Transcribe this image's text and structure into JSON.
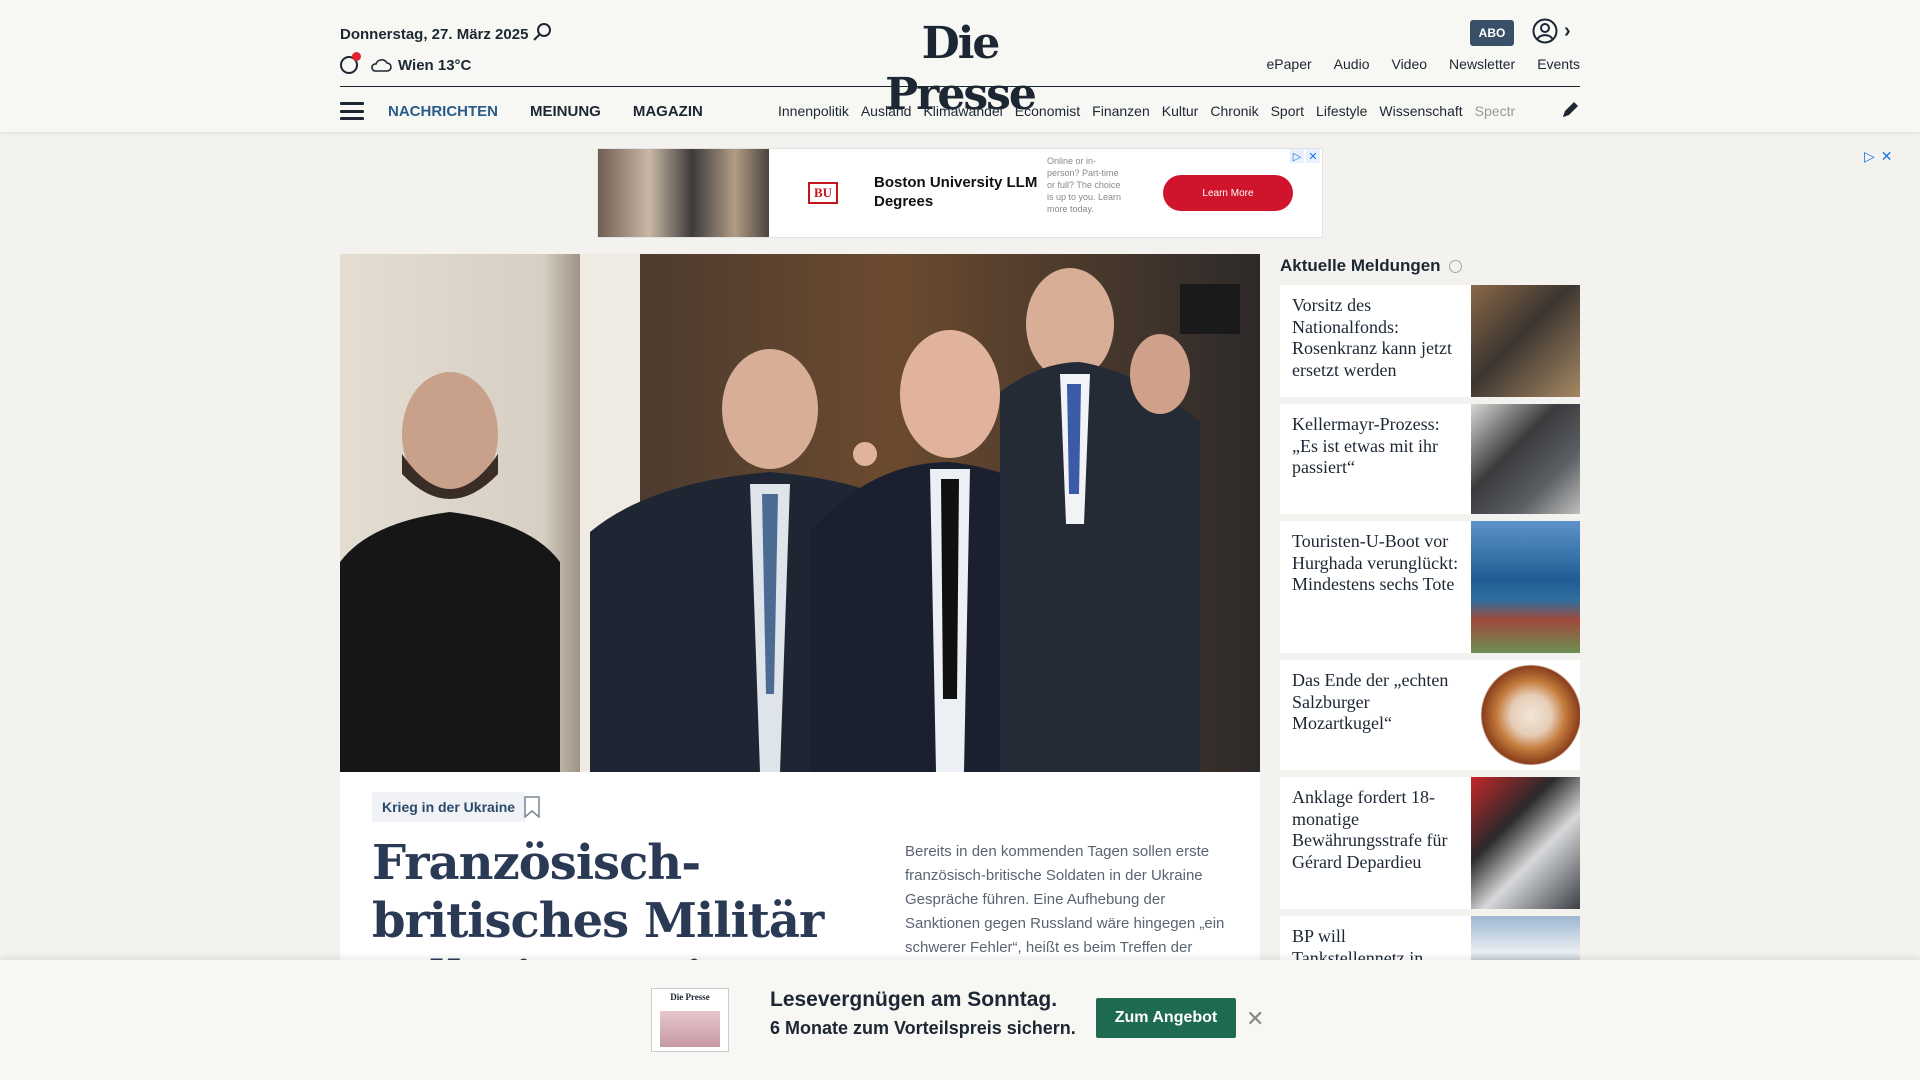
{
  "header": {
    "date": "Donnerstag, 27. März 2025",
    "weather": "Wien 13°C",
    "logo": "Die Presse",
    "abo": "ABO",
    "links": [
      "ePaper",
      "Audio",
      "Video",
      "Newsletter",
      "Events"
    ]
  },
  "nav": {
    "main": [
      "NACHRICHTEN",
      "MEINUNG",
      "MAGAZIN"
    ],
    "active_main": "NACHRICHTEN",
    "sections": [
      "Innenpolitik",
      "Ausland",
      "Klimawandel",
      "Economist",
      "Finanzen",
      "Kultur",
      "Chronik",
      "Sport",
      "Lifestyle",
      "Wissenschaft",
      "Spectr"
    ]
  },
  "ad": {
    "logo_text": "BU",
    "title": "Boston University LLM Degrees",
    "description": "Online or in-person? Part-time or full? The choice is up to you. Learn more today.",
    "cta": "Learn More"
  },
  "hero": {
    "kicker": "Krieg in der Ukraine",
    "title": "Französisch-britisches Militär soll Einsatz im",
    "teaser": "Bereits in den kommenden Tagen sollen erste französisch-britische Soldaten in der Ukraine Gespräche führen. Eine Aufhebung der Sanktionen gegen Russland wäre hingegen „ein schwerer Fehler“, heißt es beim Treffen der"
  },
  "sidebar": {
    "title": "Aktuelle Meldungen",
    "items": [
      {
        "title": "Vorsitz des Nationalfonds: Rosenkranz kann jetzt ersetzt werden"
      },
      {
        "title": "Kellermayr-Prozess: „Es ist etwas mit ihr passiert“"
      },
      {
        "title": "Touristen-U-Boot vor Hurghada verunglückt: Mindestens sechs Tote"
      },
      {
        "title": "Das Ende der „echten Salzburger Mozartkugel“"
      },
      {
        "title": "Anklage fordert 18-monatige Bewährungsstrafe für Gérard Depardieu"
      },
      {
        "title": "BP will Tankstellennetz in"
      }
    ]
  },
  "promo": {
    "paper_title": "Die Presse",
    "headline": "Lesevergnügen am Sonntag.",
    "subline": "6 Monate zum Vorteilspreis sichern.",
    "button": "Zum Angebot"
  },
  "colors": {
    "accent_blue": "#2a5c8a",
    "abo_bg": "#3a5068",
    "ad_cta": "#d0142b",
    "promo_btn": "#1f6b52",
    "weather_dot": "#e3232b"
  }
}
